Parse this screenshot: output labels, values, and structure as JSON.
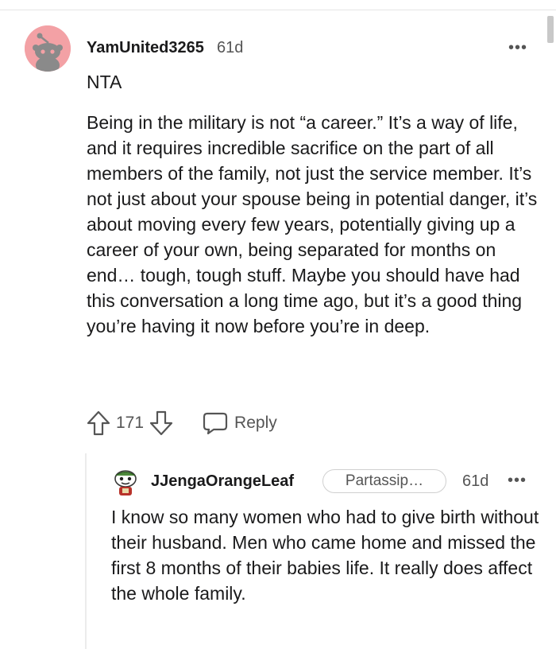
{
  "comment": {
    "username": "YamUnited3265",
    "age": "61d",
    "more_label": "•••",
    "verdict": "NTA",
    "body": "Being in the military is not “a career.” It’s a way of life, and it requires incredible sacrifice on the part of all members of the family, not just the service member. It’s not just about your spouse being in potential danger, it’s about moving every few years, potentially giving up a career of your own, being separated for months on end… tough, tough stuff. Maybe you should have had this conversation a long time ago, but it’s a good thing you’re having it now before you’re in deep.",
    "score": "171",
    "reply_label": "Reply",
    "avatar_color": "#f3a1a5"
  },
  "reply": {
    "username": "JJengaOrangeLeaf",
    "flair": "Partassip…",
    "age": "61d",
    "more_label": "•••",
    "body": "I know so many women who had to give birth without their husband. Men who came home and missed the first 8 months of their babies life. It really does affect the whole family."
  },
  "icons": {
    "upvote": "arrow-up-icon",
    "downvote": "arrow-down-icon",
    "reply": "speech-bubble-icon",
    "more": "more-dots-icon"
  }
}
